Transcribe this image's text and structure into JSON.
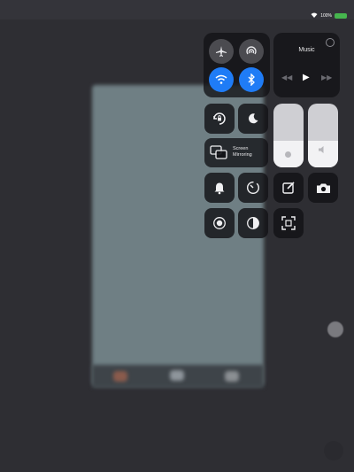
{
  "status_bar": {
    "battery_text": "100%",
    "battery_color": "#46b64e"
  },
  "background": {
    "top_left_text": "",
    "app_preview_color": "#6f7f84"
  },
  "connectivity": {
    "airplane": {
      "icon": "airplane-icon",
      "on": false
    },
    "airdrop": {
      "icon": "airdrop-icon",
      "on": false
    },
    "wifi": {
      "icon": "wifi-icon",
      "on": true
    },
    "bluetooth": {
      "icon": "bluetooth-icon",
      "on": true
    }
  },
  "music": {
    "title": "Music",
    "prev_icon": "backward-icon",
    "play_icon": "play-icon",
    "next_icon": "forward-icon"
  },
  "controls": {
    "rotation_lock": {
      "icon": "rotation-lock-icon"
    },
    "do_not_disturb": {
      "icon": "moon-icon"
    },
    "screen_mirroring": {
      "label": "Screen\nMirroring",
      "icon": "screen-mirroring-icon"
    },
    "silent_mode": {
      "icon": "bell-icon"
    },
    "timer": {
      "icon": "timer-icon"
    },
    "screen_record": {
      "icon": "record-icon"
    },
    "dark_mode": {
      "icon": "dark-mode-icon"
    },
    "notes": {
      "icon": "note-icon"
    },
    "camera": {
      "icon": "camera-icon"
    },
    "scanner": {
      "icon": "scan-icon"
    }
  },
  "sliders": {
    "brightness": {
      "level": 0.42,
      "icon": "sun-icon"
    },
    "volume": {
      "level": 0.42,
      "icon": "speaker-icon"
    }
  },
  "accent_colors": {
    "active": "#1f7cf6",
    "tile": "#121216",
    "button": "#4b4b50"
  }
}
